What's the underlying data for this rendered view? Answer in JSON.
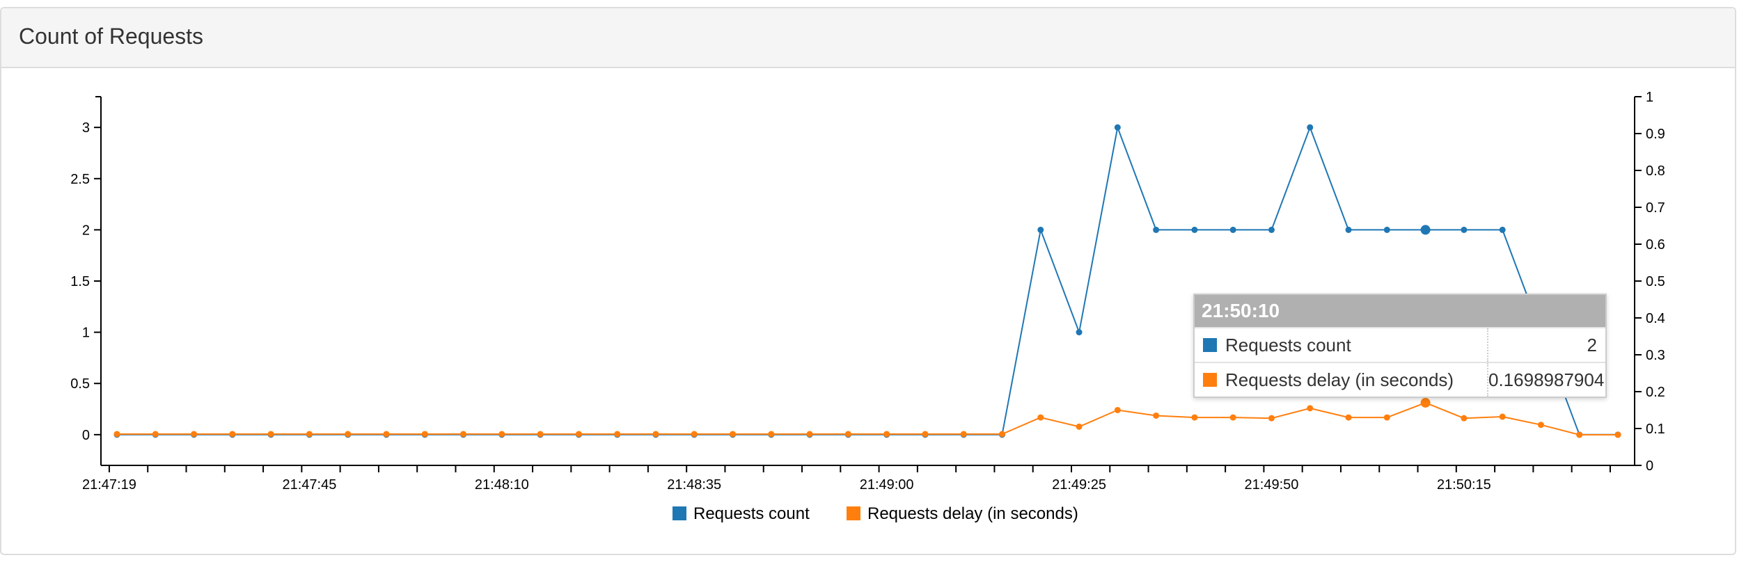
{
  "panel": {
    "title": "Count of Requests"
  },
  "colors": {
    "count": "#1f77b4",
    "delay": "#ff7f0e"
  },
  "tooltip": {
    "time": "21:50:10",
    "rows": [
      {
        "name": "Requests count",
        "value": "2",
        "color": "#1f77b4"
      },
      {
        "name": "Requests delay (in seconds)",
        "value": "0.1698987904",
        "color": "#ff7f0e"
      }
    ]
  },
  "chart_data": {
    "type": "line",
    "title": "Count of Requests",
    "x_tick_labels": [
      "21:47:19",
      "21:47:45",
      "21:48:10",
      "21:48:35",
      "21:49:00",
      "21:49:25",
      "21:49:50",
      "21:50:15"
    ],
    "x": [
      "21:47:20",
      "21:47:25",
      "21:47:30",
      "21:47:35",
      "21:47:40",
      "21:47:45",
      "21:47:50",
      "21:47:55",
      "21:48:00",
      "21:48:05",
      "21:48:10",
      "21:48:15",
      "21:48:20",
      "21:48:25",
      "21:48:30",
      "21:48:35",
      "21:48:40",
      "21:48:45",
      "21:48:50",
      "21:48:55",
      "21:49:00",
      "21:49:05",
      "21:49:10",
      "21:49:15",
      "21:49:20",
      "21:49:25",
      "21:49:30",
      "21:49:35",
      "21:49:40",
      "21:49:45",
      "21:49:50",
      "21:49:55",
      "21:50:00",
      "21:50:05",
      "21:50:10",
      "21:50:15",
      "21:50:20",
      "21:50:25",
      "21:50:30",
      "21:50:35"
    ],
    "y_left_ticks": [
      "0",
      "0.5",
      "1",
      "1.5",
      "2",
      "2.5",
      "3"
    ],
    "y_right_ticks": [
      "0",
      "0.1",
      "0.2",
      "0.3",
      "0.4",
      "0.5",
      "0.6",
      "0.7",
      "0.8",
      "0.9",
      "1"
    ],
    "ylim_left": [
      -0.3,
      3.3
    ],
    "ylim_right": [
      0,
      1
    ],
    "grid": false,
    "legend_position": "bottom-center",
    "highlight_index": 34,
    "series": [
      {
        "name": "Requests count",
        "axis": "left",
        "color": "#1f77b4",
        "values": [
          0,
          0,
          0,
          0,
          0,
          0,
          0,
          0,
          0,
          0,
          0,
          0,
          0,
          0,
          0,
          0,
          0,
          0,
          0,
          0,
          0,
          0,
          0,
          0,
          2,
          1,
          3,
          2,
          2,
          2,
          2,
          3,
          2,
          2,
          2,
          2,
          2,
          1,
          0,
          0
        ]
      },
      {
        "name": "Requests delay (in seconds)",
        "axis": "right",
        "color": "#ff7f0e",
        "values": [
          0.085,
          0.085,
          0.085,
          0.085,
          0.085,
          0.085,
          0.085,
          0.085,
          0.085,
          0.085,
          0.085,
          0.085,
          0.085,
          0.085,
          0.085,
          0.085,
          0.085,
          0.085,
          0.085,
          0.085,
          0.085,
          0.085,
          0.085,
          0.085,
          0.13,
          0.105,
          0.15,
          0.135,
          0.13,
          0.13,
          0.128,
          0.155,
          0.13,
          0.13,
          0.1699,
          0.128,
          0.132,
          0.11,
          0.083,
          0.083
        ]
      }
    ]
  }
}
